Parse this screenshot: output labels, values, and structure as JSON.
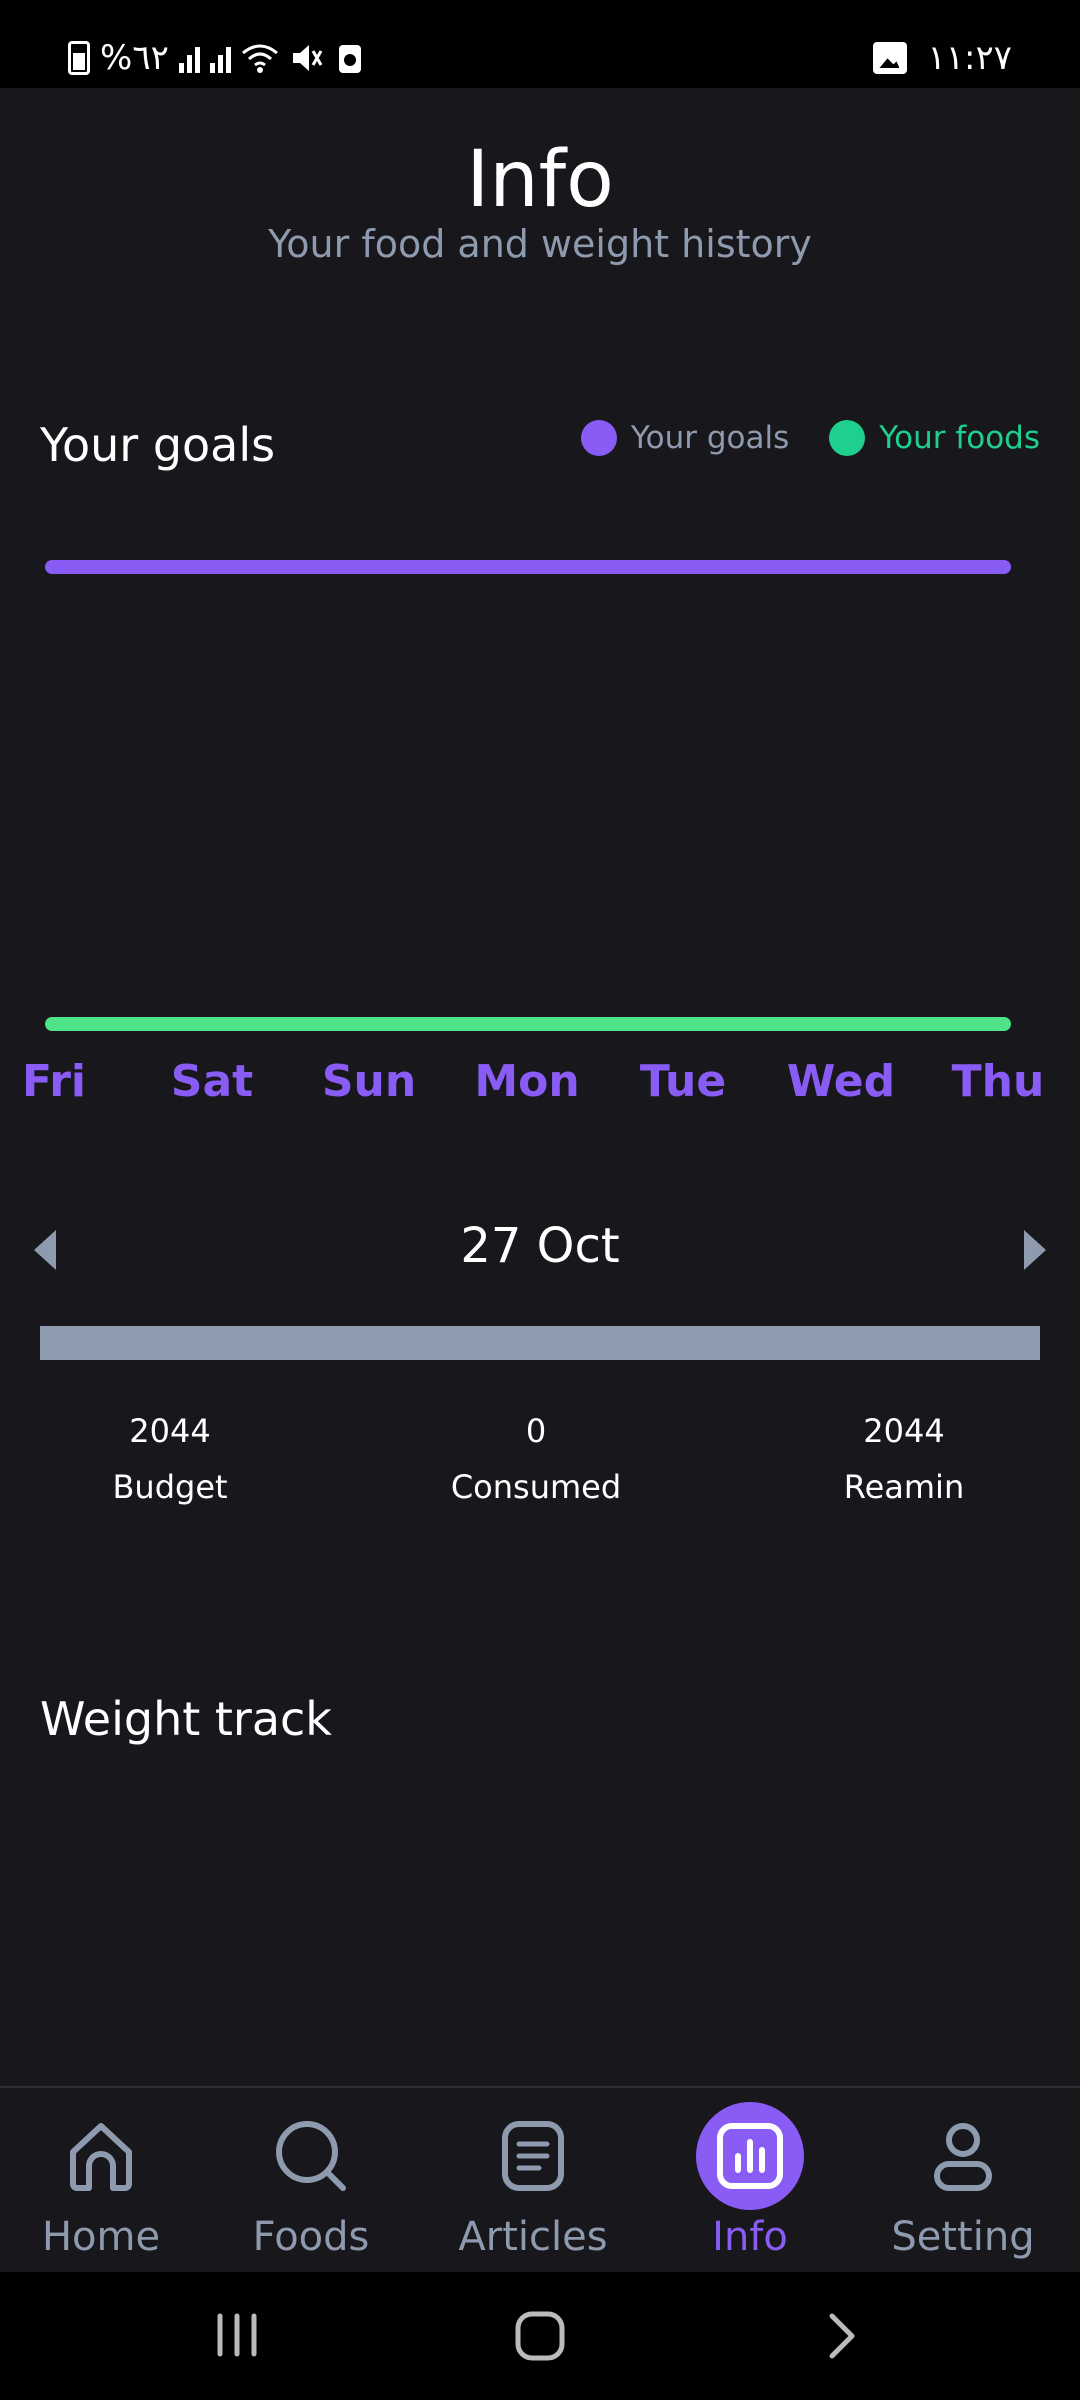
{
  "status_bar": {
    "battery_text": "%٦٢",
    "time": "١١:٢٧"
  },
  "header": {
    "title": "Info",
    "subtitle": "Your food and weight history"
  },
  "goals": {
    "title": "Your goals",
    "legend": [
      {
        "label": "Your goals",
        "color": "#8a5cf6"
      },
      {
        "label": "Your foods",
        "color": "#1ecf8e"
      }
    ]
  },
  "chart_data": {
    "type": "line",
    "categories": [
      "Fri",
      "Sat",
      "Sun",
      "Mon",
      "Tue",
      "Wed",
      "Thu"
    ],
    "series": [
      {
        "name": "Your goals",
        "color": "#8a5cf6",
        "values": [
          2044,
          2044,
          2044,
          2044,
          2044,
          2044,
          2044
        ]
      },
      {
        "name": "Your foods",
        "color": "#4ee28a",
        "values": [
          0,
          0,
          0,
          0,
          0,
          0,
          0
        ]
      }
    ],
    "ylim": [
      0,
      2044
    ],
    "grid": false,
    "legend": "top-right"
  },
  "day_summary": {
    "date": "27 Oct",
    "progress_fraction": 0,
    "budget_value": "2044",
    "budget_label": "Budget",
    "consumed_value": "0",
    "consumed_label": "Consumed",
    "remain_value": "2044",
    "remain_label": "Reamin"
  },
  "weight": {
    "title": "Weight track"
  },
  "bottom_nav": {
    "items": [
      {
        "label": "Home",
        "icon": "home-icon"
      },
      {
        "label": "Foods",
        "icon": "search-icon"
      },
      {
        "label": "Articles",
        "icon": "document-icon"
      },
      {
        "label": "Info",
        "icon": "bar-chart-icon",
        "active": true
      },
      {
        "label": "Setting",
        "icon": "person-icon"
      }
    ]
  },
  "colors": {
    "accent": "#8a5cf6",
    "green": "#4ee28a",
    "muted": "#8e9aae",
    "background": "#18171c"
  }
}
